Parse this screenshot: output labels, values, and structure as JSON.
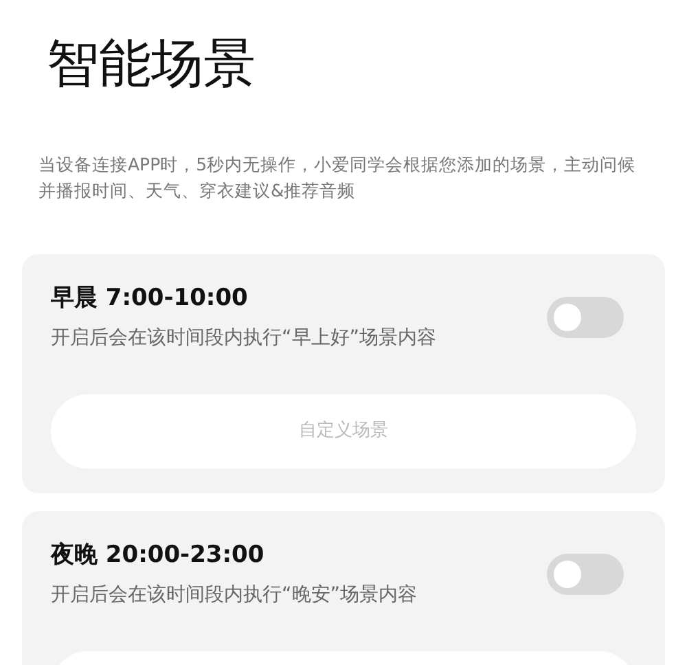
{
  "page": {
    "title": "智能场景",
    "description": "当设备连接APP时，5秒内无操作，小爱同学会根据您添加的场景，主动问候并播报时间、天气、穿衣建议&推荐音频"
  },
  "scenes": [
    {
      "title": "早晨 7:00-10:00",
      "description": "开启后会在该时间段内执行“早上好”场景内容",
      "on": false,
      "button_label": "自定义场景"
    },
    {
      "title": "夜晚 20:00-23:00",
      "description": "开启后会在该时间段内执行“晚安”场景内容",
      "on": false
    }
  ]
}
